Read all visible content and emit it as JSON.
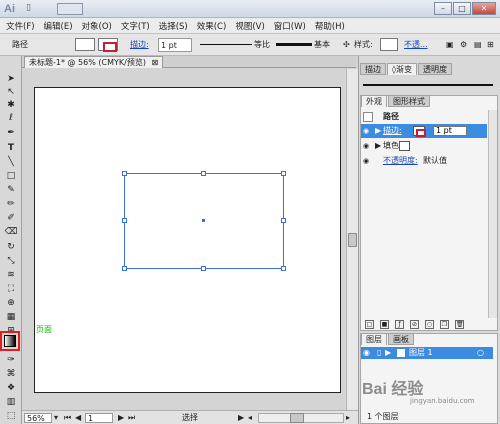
{
  "title_bar": {
    "app_logo": "Ai"
  },
  "menu": [
    "文件(F)",
    "编辑(E)",
    "对象(O)",
    "文字(T)",
    "选择(S)",
    "效果(C)",
    "视图(V)",
    "窗口(W)",
    "帮助(H)"
  ],
  "control_bar": {
    "object_type": "路径",
    "stroke_link": "描边:",
    "stroke_weight": "1 pt",
    "profile": "等比",
    "brush": "基本",
    "style_label": "样式:",
    "opacity_link": "不透..."
  },
  "document": {
    "tab_title": "未标题-1* @ 56% (CMYK/预览)",
    "tab_close": "⊠"
  },
  "canvas": {
    "green_label": "页面"
  },
  "status_bar": {
    "zoom": "56%",
    "page": "1",
    "status": "选择"
  },
  "panels": {
    "top_tabs": [
      "描边",
      "◊渐变",
      "透明度"
    ],
    "appearance": {
      "tabs": [
        "外观",
        "图形样式"
      ],
      "header": "路径",
      "stroke_label": "描边:",
      "stroke_weight": "1 pt",
      "fill_label": "填色:",
      "opacity_label": "不透明度:",
      "opacity_value": "默认值"
    },
    "layers": {
      "tabs": [
        "图层",
        "画板"
      ],
      "layer_name": "图层 1",
      "status": "1 个图层"
    }
  },
  "watermark": {
    "text": "Bai 经验",
    "sub": "jingyan.baidu.com"
  },
  "colors": {
    "selection": "#3b6fd6",
    "highlight": "#e02020",
    "stroke_swatch": "#c0203a",
    "label_green": "#18b318",
    "panel_select": "#3b8be0"
  }
}
